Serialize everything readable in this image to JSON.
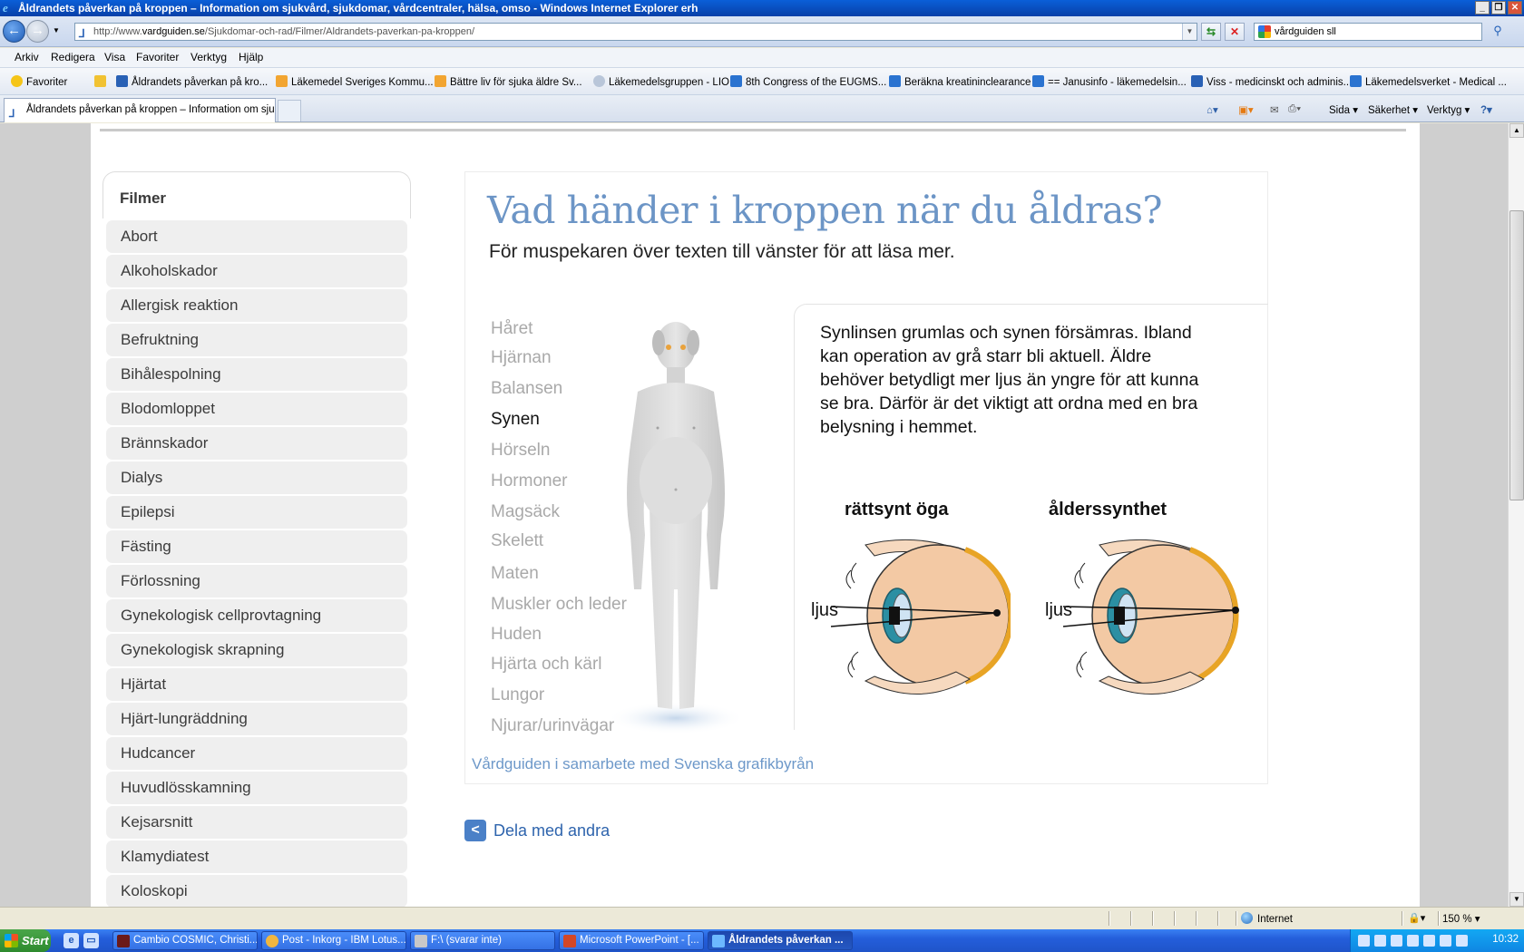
{
  "window": {
    "title": "Åldrandets påverkan på kroppen – Information om sjukvård, sjukdomar, vårdcentraler, hälsa, omso - Windows Internet Explorer erh",
    "controls": [
      "_",
      "❐",
      "✕"
    ]
  },
  "address": {
    "url_prefix": "http://www.",
    "url_domain": "vardguiden.se",
    "url_path": "/Sjukdomar-och-rad/Filmer/Aldrandets-paverkan-pa-kroppen/",
    "search_value": "vårdguiden sll"
  },
  "menu": [
    "Arkiv",
    "Redigera",
    "Visa",
    "Favoriter",
    "Verktyg",
    "Hjälp"
  ],
  "favorites": {
    "label": "Favoriter",
    "links": [
      "Åldrandets påverkan på kro...",
      "Läkemedel  Sveriges Kommu...",
      "Bättre liv för sjuka äldre  Sv...",
      "Läkemedelsgruppen - LIO",
      "8th Congress of the EUGMS...",
      "Beräkna kreatininclearance",
      "== Janusinfo - läkemedelsin...",
      "Viss - medicinskt och adminis...",
      "Läkemedelsverket - Medical ..."
    ]
  },
  "tabs": {
    "active": "Åldrandets påverkan på kroppen – Information om sjuk...",
    "commands": [
      "Sida ▾",
      "Säkerhet ▾",
      "Verktyg ▾"
    ]
  },
  "sidebar": {
    "heading": "Filmer",
    "items": [
      "Abort",
      "Alkoholskador",
      "Allergisk reaktion",
      "Befruktning",
      "Bihålespolning",
      "Blodomloppet",
      "Brännskador",
      "Dialys",
      "Epilepsi",
      "Fästing",
      "Förlossning",
      "Gynekologisk cellprovtagning",
      "Gynekologisk skrapning",
      "Hjärtat",
      "Hjärt-lungräddning",
      "Hudcancer",
      "Huvudlösskamning",
      "Kejsarsnitt",
      "Klamydiatest",
      "Koloskopi"
    ]
  },
  "main": {
    "heading": "Vad händer i kroppen när du åldras?",
    "subheading": "För muspekaren över texten till vänster för att läsa mer.",
    "body_parts": [
      "Håret",
      "Hjärnan",
      "Balansen",
      "Synen",
      "Hörseln",
      "Hormoner",
      "Magsäck",
      "Skelett",
      "Maten",
      "Muskler och leder",
      "Huden",
      "Hjärta och kärl",
      "Lungor",
      "Njurar/urinvägar"
    ],
    "active_part": "Synen",
    "info_text": "Synlinsen grumlas och synen försämras. Ibland kan operation av grå starr bli aktuell. Äldre behöver betydligt mer ljus än yngre för att kunna se bra. Därför är det viktigt att ordna med en bra belysning i hemmet.",
    "eye_normal_label": "rättsynt öga",
    "eye_aged_label": "ålderssynthet",
    "light_label": "ljus",
    "credit": "Vårdguiden i samarbete med Svenska grafikbyrån",
    "share_label": "Dela med andra"
  },
  "status": {
    "zone": "Internet",
    "zoom": "150 %"
  },
  "taskbar": {
    "start": "Start",
    "tasks": [
      "Cambio COSMIC, Christi...",
      "Post - Inkorg - IBM Lotus...",
      "F:\\ (svarar inte)",
      "Microsoft PowerPoint - [...",
      "Åldrandets påverkan ..."
    ],
    "clock": "10:32"
  },
  "colors": {
    "heading_blue": "#6c95c6",
    "link_blue": "#2e64ad",
    "sidebar_item_bg": "#efefef",
    "xp_taskbar": "#245edb"
  }
}
